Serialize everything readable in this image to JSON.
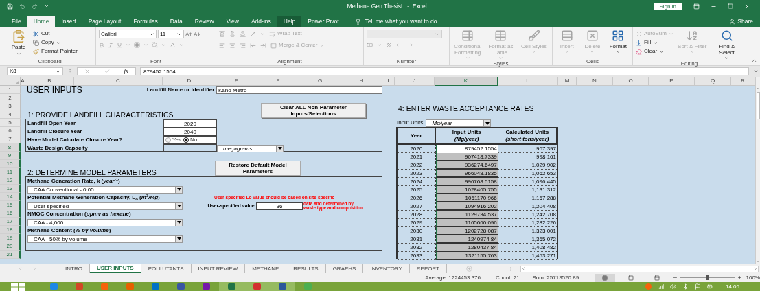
{
  "window": {
    "title": "Methane Gen ThesisL  -  Excel",
    "sign_in": "Sign in"
  },
  "ribbon_tabs": [
    {
      "label": "File",
      "selected": false,
      "hovered": false
    },
    {
      "label": "Home",
      "selected": true,
      "hovered": false
    },
    {
      "label": "Insert",
      "selected": false,
      "hovered": false
    },
    {
      "label": "Page Layout",
      "selected": false,
      "hovered": false
    },
    {
      "label": "Formulas",
      "selected": false,
      "hovered": false
    },
    {
      "label": "Data",
      "selected": false,
      "hovered": false
    },
    {
      "label": "Review",
      "selected": false,
      "hovered": false
    },
    {
      "label": "View",
      "selected": false,
      "hovered": false
    },
    {
      "label": "Add-ins",
      "selected": false,
      "hovered": false
    },
    {
      "label": "Help",
      "selected": false,
      "hovered": true
    },
    {
      "label": "Power Pivot",
      "selected": false,
      "hovered": false
    }
  ],
  "tell_me": "Tell me what you want to do",
  "share": "Share",
  "ribbon": {
    "clipboard": {
      "label": "Clipboard",
      "paste": "Paste",
      "cut": "Cut",
      "copy": "Copy",
      "format_painter": "Format Painter"
    },
    "font": {
      "label": "Font",
      "font_name": "Calibri",
      "font_size": "11"
    },
    "alignment": {
      "label": "Alignment",
      "wrap_text": "Wrap Text",
      "merge": "Merge & Center",
      "disabled": true
    },
    "number": {
      "label": "Number",
      "disabled": true
    },
    "styles": {
      "label": "Styles",
      "buttons": [
        {
          "label": "Conditional Formatting",
          "disabled": true
        },
        {
          "label": "Format as Table",
          "disabled": true
        },
        {
          "label": "Cell Styles",
          "disabled": true
        }
      ]
    },
    "cells": {
      "label": "Cells",
      "buttons": [
        {
          "label": "Insert",
          "disabled": true
        },
        {
          "label": "Delete",
          "disabled": true
        },
        {
          "label": "Format",
          "disabled": false
        }
      ]
    },
    "editing": {
      "label": "Editing",
      "small": [
        {
          "label": "AutoSum",
          "disabled": true
        },
        {
          "label": "Fill",
          "disabled": false
        },
        {
          "label": "Clear",
          "disabled": false
        }
      ],
      "large": [
        {
          "label": "Sort & Filter",
          "disabled": true
        },
        {
          "label": "Find & Select",
          "disabled": false
        }
      ]
    }
  },
  "formula_bar": {
    "name_box": "K8",
    "function_label": "fx",
    "value": "879452.1554"
  },
  "sheet": {
    "columns": [
      {
        "label": "A",
        "selected": false
      },
      {
        "label": "B",
        "selected": false
      },
      {
        "label": "C",
        "selected": false
      },
      {
        "label": "D",
        "selected": false
      },
      {
        "label": "E",
        "selected": false
      },
      {
        "label": "F",
        "selected": false
      },
      {
        "label": "G",
        "selected": false
      },
      {
        "label": "H",
        "selected": false
      },
      {
        "label": "I",
        "selected": false
      },
      {
        "label": "J",
        "selected": false
      },
      {
        "label": "K",
        "selected": true
      },
      {
        "label": "L",
        "selected": false
      },
      {
        "label": "M",
        "selected": false
      },
      {
        "label": "N",
        "selected": false
      },
      {
        "label": "O",
        "selected": false
      },
      {
        "label": "P",
        "selected": false
      },
      {
        "label": "Q",
        "selected": false
      },
      {
        "label": "R",
        "selected": false
      }
    ],
    "rows": [
      {
        "label": "1",
        "selected": false
      },
      {
        "label": "2",
        "selected": false
      },
      {
        "label": "3",
        "selected": false
      },
      {
        "label": "4",
        "selected": false
      },
      {
        "label": "5",
        "selected": false
      },
      {
        "label": "6",
        "selected": false
      },
      {
        "label": "7",
        "selected": false
      },
      {
        "label": "8",
        "selected": true
      },
      {
        "label": "9",
        "selected": true
      },
      {
        "label": "10",
        "selected": true
      },
      {
        "label": "11",
        "selected": true
      },
      {
        "label": "12",
        "selected": true
      },
      {
        "label": "13",
        "selected": true
      },
      {
        "label": "14",
        "selected": true
      },
      {
        "label": "15",
        "selected": true
      },
      {
        "label": "16",
        "selected": true
      },
      {
        "label": "17",
        "selected": true
      },
      {
        "label": "18",
        "selected": true
      },
      {
        "label": "19",
        "selected": true
      },
      {
        "label": "20",
        "selected": true
      },
      {
        "label": "21",
        "selected": true
      }
    ],
    "title": "USER INPUTS",
    "name_label": "Landfill Name or Identifier:",
    "name_value": "Kano Metro",
    "clear_button": "Clear ALL Non-Parameter Inputs/Selections",
    "section_1": "1: PROVIDE LANDFILL CHARACTERISTICS",
    "characteristics": [
      {
        "kind": "value",
        "label": "Landfill Open Year",
        "value": "2020"
      },
      {
        "kind": "value",
        "label": "Landfill Closure Year",
        "value": "2040"
      },
      {
        "kind": "radio",
        "label": "Have Model Calculate Closure Year?",
        "options": [
          {
            "label": "Yes",
            "selected": false
          },
          {
            "label": "No",
            "selected": true
          }
        ]
      },
      {
        "kind": "unit",
        "label": "Waste Design Capacity",
        "unit": "megagrams"
      }
    ],
    "restore_button": "Restore Default Model Parameters",
    "section_2": "2: DETERMINE MODEL PARAMETERS",
    "parameters": [
      {
        "label": "Methane Generation Rate, k (*year*$^{-1}$)",
        "selection": "CAA Conventional - 0.05"
      },
      {
        "label": "Potential Methane Generation Capacity, L$_{o}$ (*m*$^{3}$*/Mg*)",
        "selection": "User-specified",
        "note": [
          "User-specified Lo value should be based on site-specific",
          "data and determined by",
          "waste type and composition."
        ],
        "user_value_label": "User-specified value:",
        "user_value": "36"
      },
      {
        "label": "NMOC Concentration (*ppmv as hexane*)",
        "selection": "CAA - 4,000"
      },
      {
        "label": "Methane Content (*% by volume*)",
        "selection": "CAA - 50% by volume"
      }
    ],
    "section_4": "4: ENTER WASTE ACCEPTANCE RATES",
    "input_units_label": "Input Units:",
    "input_units": "Mg/year",
    "table_columns": [
      {
        "title": "Year"
      },
      {
        "title": "Input Units",
        "subtitle": "(Mg/year)"
      },
      {
        "title": "Calculated Units",
        "subtitle": "(short tons/year)"
      }
    ],
    "table_rows": [
      {
        "year": "2020",
        "input": "879452.1554",
        "calculated": "967,397",
        "selected": true,
        "active": true
      },
      {
        "year": "2021",
        "input": "907418.7339",
        "calculated": "998,161",
        "selected": true,
        "active": false
      },
      {
        "year": "2022",
        "input": "936274.6497",
        "calculated": "1,029,902",
        "selected": true,
        "active": false
      },
      {
        "year": "2023",
        "input": "966048.1835",
        "calculated": "1,062,653",
        "selected": true,
        "active": false
      },
      {
        "year": "2024",
        "input": "996768.5158",
        "calculated": "1,096,445",
        "selected": true,
        "active": false
      },
      {
        "year": "2025",
        "input": "1028465.755",
        "calculated": "1,131,312",
        "selected": true,
        "active": false
      },
      {
        "year": "2026",
        "input": "1061170.966",
        "calculated": "1,167,288",
        "selected": true,
        "active": false
      },
      {
        "year": "2027",
        "input": "1094916.202",
        "calculated": "1,204,408",
        "selected": true,
        "active": false
      },
      {
        "year": "2028",
        "input": "1129734.537",
        "calculated": "1,242,708",
        "selected": true,
        "active": false
      },
      {
        "year": "2029",
        "input": "1165660.096",
        "calculated": "1,282,226",
        "selected": true,
        "active": false
      },
      {
        "year": "2030",
        "input": "1202728.087",
        "calculated": "1,323,001",
        "selected": true,
        "active": false
      },
      {
        "year": "2031",
        "input": "1240974.84",
        "calculated": "1,365,072",
        "selected": true,
        "active": false
      },
      {
        "year": "2032",
        "input": "1280437.84",
        "calculated": "1,408,482",
        "selected": true,
        "active": false
      },
      {
        "year": "2033",
        "input": "1321155.763",
        "calculated": "1,453,271",
        "selected": true,
        "active": false
      }
    ]
  },
  "sheet_tabs": [
    {
      "label": "INTRO",
      "selected": false
    },
    {
      "label": "USER INPUTS",
      "selected": true
    },
    {
      "label": "POLLUTANTS",
      "selected": false
    },
    {
      "label": "INPUT REVIEW",
      "selected": false
    },
    {
      "label": "METHANE",
      "selected": false
    },
    {
      "label": "RESULTS",
      "selected": false
    },
    {
      "label": "GRAPHS",
      "selected": false
    },
    {
      "label": "INVENTORY",
      "selected": false
    },
    {
      "label": "REPORT",
      "selected": false
    }
  ],
  "status_bar": {
    "average": "Average: 1224453.376",
    "count": "Count: 21",
    "sum": "Sum: 25713520.89",
    "views": [
      {
        "selected": true
      },
      {
        "selected": false
      },
      {
        "selected": false
      }
    ],
    "zoom": {
      "level": 0.5,
      "label": "100%"
    }
  },
  "taskbar": {
    "apps": [
      {
        "color": "#1e88e5",
        "running": false
      },
      {
        "color": "#d24726",
        "running": false
      },
      {
        "color": "#f7630c",
        "running": false
      },
      {
        "color": "#e66000",
        "running": false
      },
      {
        "color": "#0072c6",
        "running": false
      },
      {
        "color": "#3955a3",
        "running": false
      },
      {
        "color": "#7719aa",
        "running": false
      },
      {
        "color": "#217346",
        "running": true
      },
      {
        "color": "#d32f2f",
        "running": true
      },
      {
        "color": "#2b579a",
        "running": true
      },
      {
        "color": "#4caf50",
        "running": false
      }
    ],
    "time": "14:06"
  }
}
